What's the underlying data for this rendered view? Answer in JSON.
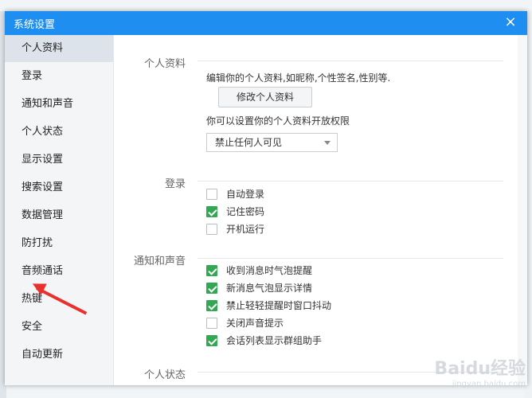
{
  "window": {
    "title": "系统设置",
    "close_label": "×"
  },
  "sidebar": {
    "items": [
      {
        "label": "个人资料",
        "active": true
      },
      {
        "label": "登录"
      },
      {
        "label": "通知和声音"
      },
      {
        "label": "个人状态"
      },
      {
        "label": "显示设置"
      },
      {
        "label": "搜索设置"
      },
      {
        "label": "数据管理"
      },
      {
        "label": "防打扰"
      },
      {
        "label": "音频通话"
      },
      {
        "label": "热键"
      },
      {
        "label": "安全"
      },
      {
        "label": "自动更新"
      }
    ]
  },
  "sections": {
    "profile": {
      "label": "个人资料",
      "desc": "编辑你的个人资料,如昵称,个性签名,性别等.",
      "edit_button": "修改个人资料",
      "privacy_text": "你可以设置你的个人资料开放权限",
      "privacy_select": "禁止任何人可见"
    },
    "login": {
      "label": "登录",
      "options": [
        {
          "label": "自动登录",
          "checked": false
        },
        {
          "label": "记住密码",
          "checked": true
        },
        {
          "label": "开机运行",
          "checked": false
        }
      ]
    },
    "notify": {
      "label": "通知和声音",
      "options": [
        {
          "label": "收到消息时气泡提醒",
          "checked": true
        },
        {
          "label": "新消息气泡显示详情",
          "checked": true
        },
        {
          "label": "禁止轻轻提醒时窗口抖动",
          "checked": true
        },
        {
          "label": "关闭声音提示",
          "checked": false
        },
        {
          "label": "会话列表显示群组助手",
          "checked": true
        }
      ]
    },
    "status": {
      "label": "个人状态"
    }
  },
  "watermark": {
    "main": "Baidu经验",
    "sub": "jingyan.baidu.com"
  },
  "colors": {
    "titlebar": "#1f8ef1",
    "check": "#33a852",
    "arrow": "#e9302c"
  }
}
